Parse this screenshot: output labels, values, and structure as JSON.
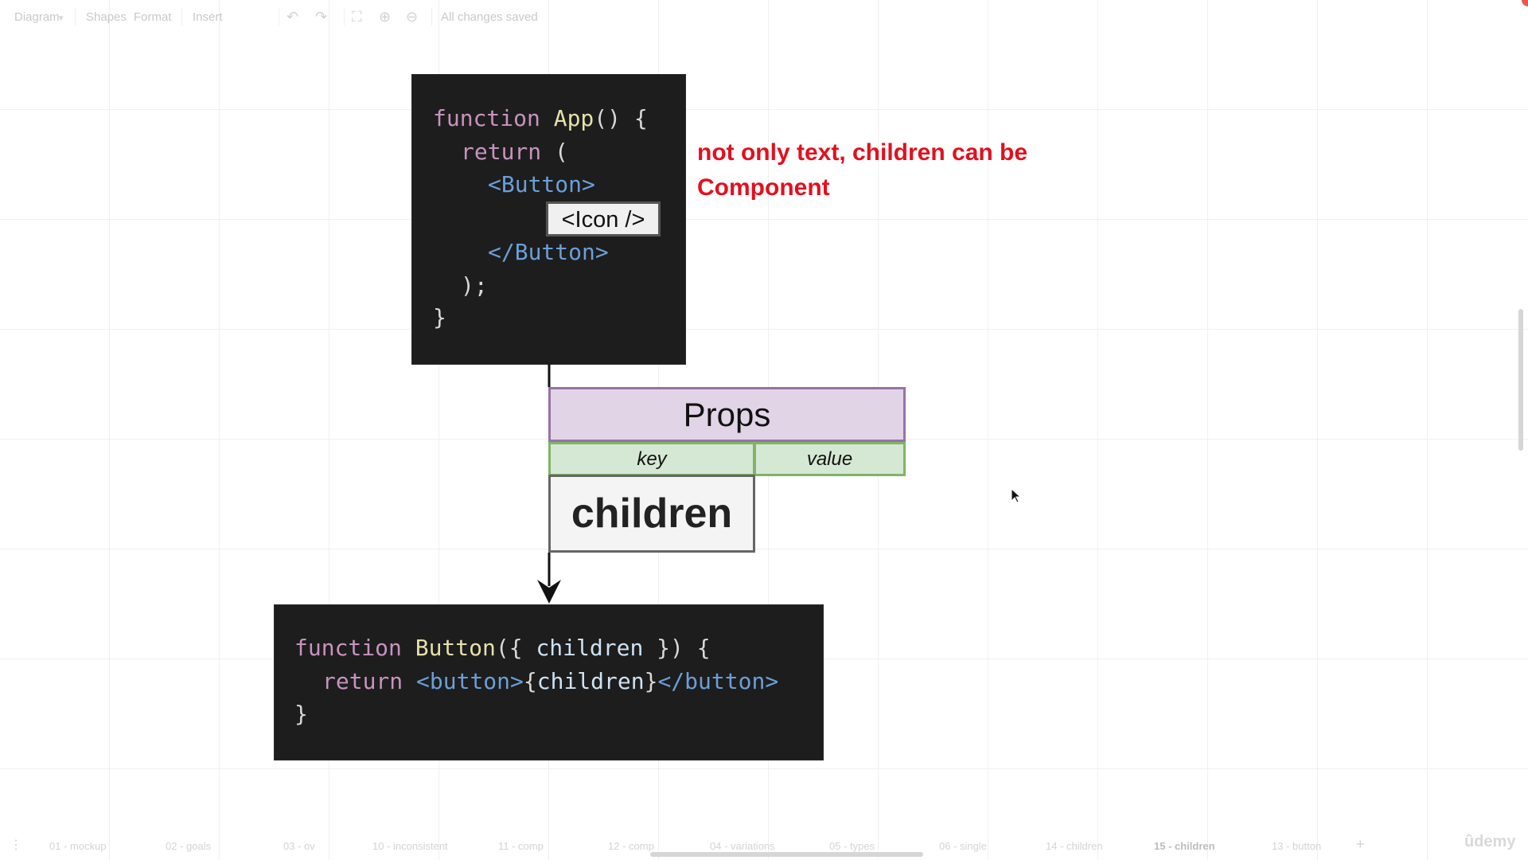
{
  "toolbar": {
    "menu_diagram": "Diagram",
    "menu_shapes": "Shapes",
    "menu_format": "Format",
    "menu_insert": "Insert",
    "status": "All changes saved"
  },
  "app_code": {
    "line1": [
      "function",
      " ",
      "App",
      "() {"
    ],
    "line2": [
      "return",
      " ("
    ],
    "line3": "<Button>",
    "icon_component": "<Icon />",
    "line5": "</Button>",
    "line6": ");",
    "line7": "}"
  },
  "note": {
    "text": "not only text, children can be Component",
    "color": "#e3101e"
  },
  "props": {
    "title": "Props",
    "key_header": "key",
    "value_header": "value",
    "children_key": "children"
  },
  "button_code": {
    "line1": [
      "function",
      " ",
      "Button",
      "({ ",
      "children",
      " }) {"
    ],
    "line2": [
      "return",
      " ",
      "<button>",
      "{",
      "children",
      "}",
      "</button>"
    ],
    "line3": "}"
  },
  "pages": [
    {
      "label": "01 - mockup",
      "active": false
    },
    {
      "label": "02 - goals",
      "active": false
    },
    {
      "label": "03 - ov",
      "active": false
    },
    {
      "label": "10 - inconsistent",
      "active": false
    },
    {
      "label": "11 - comp",
      "active": false
    },
    {
      "label": "12 - comp",
      "active": false
    },
    {
      "label": "04 - variations",
      "active": false
    },
    {
      "label": "05 - types",
      "active": false
    },
    {
      "label": "06 - single",
      "active": false
    },
    {
      "label": "14 - children",
      "active": false
    },
    {
      "label": "15 - children",
      "active": true
    },
    {
      "label": "13 - button",
      "active": false
    }
  ],
  "watermark": "ûdemy",
  "colors": {
    "code_bg": "#1d1d1d",
    "props_header_fill": "#e1d4e7",
    "props_header_stroke": "#9673a6",
    "key_value_fill": "#d5e8d4",
    "key_value_stroke": "#82b366"
  }
}
